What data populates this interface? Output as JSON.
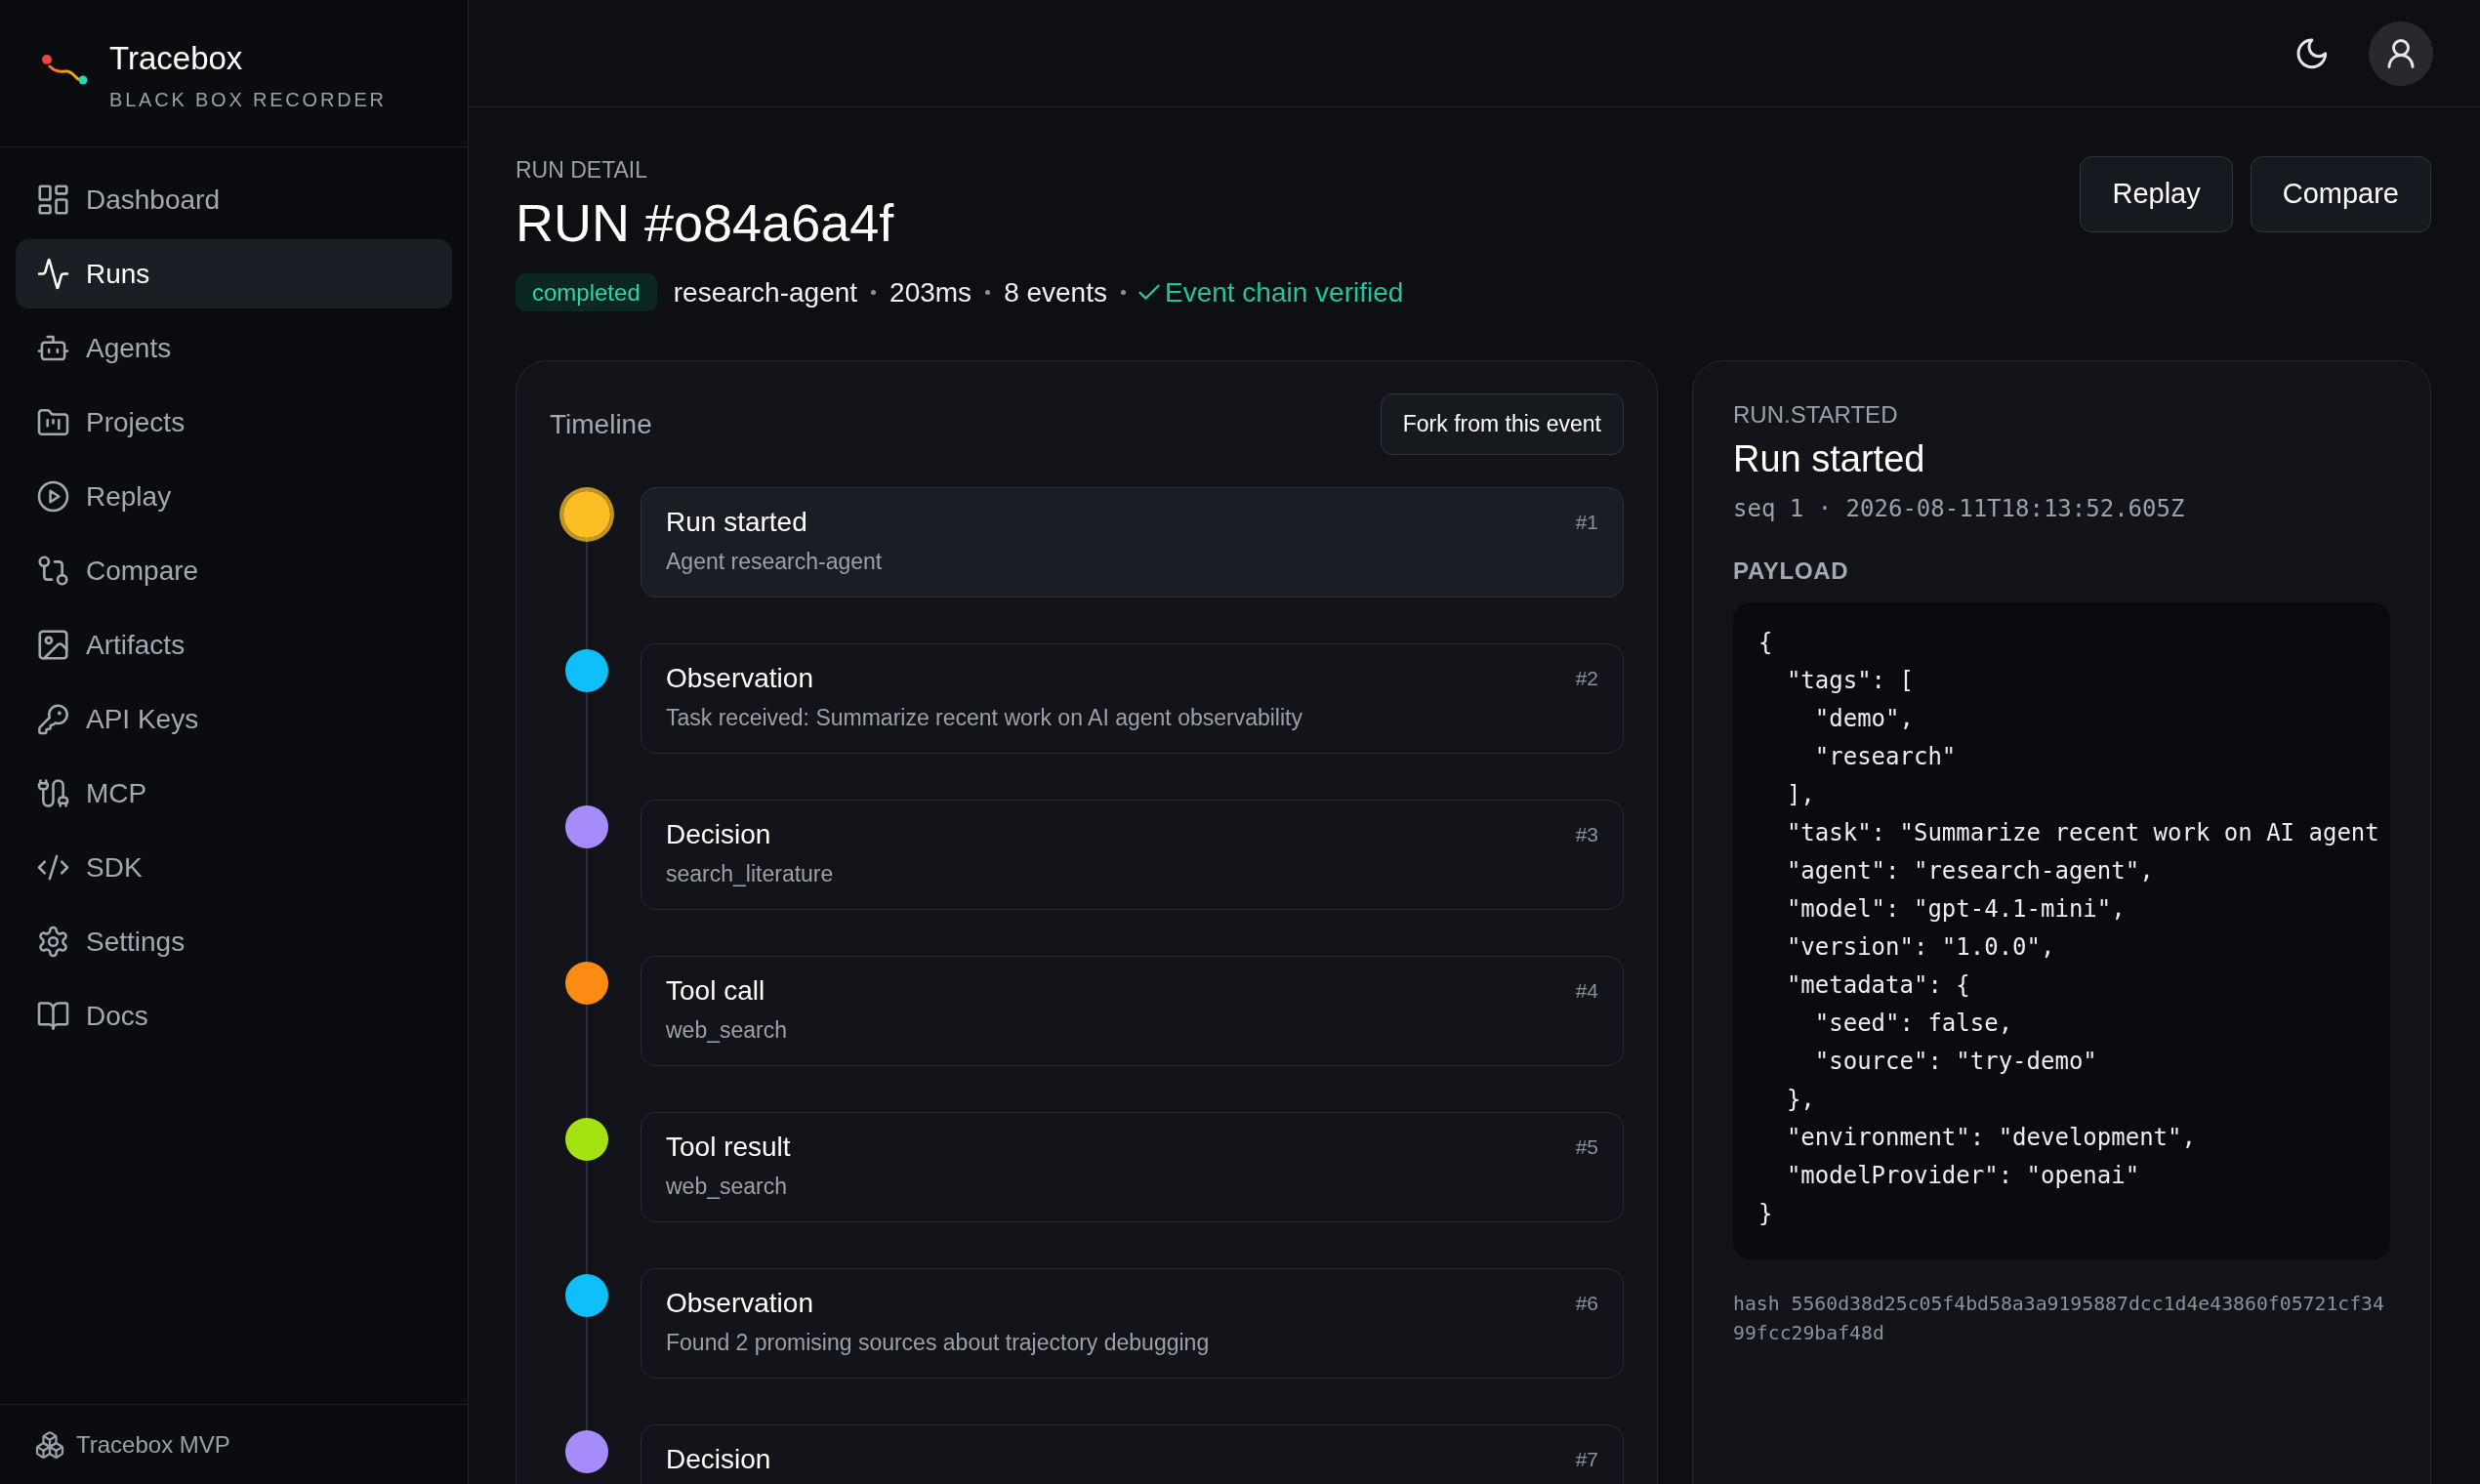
{
  "sidebar": {
    "brand": {
      "name": "Tracebox",
      "tagline": "BLACK BOX RECORDER"
    },
    "items": [
      {
        "label": "Dashboard",
        "selected": false
      },
      {
        "label": "Runs",
        "selected": true
      },
      {
        "label": "Agents",
        "selected": false
      },
      {
        "label": "Projects",
        "selected": false
      },
      {
        "label": "Replay",
        "selected": false
      },
      {
        "label": "Compare",
        "selected": false
      },
      {
        "label": "Artifacts",
        "selected": false
      },
      {
        "label": "API Keys",
        "selected": false
      },
      {
        "label": "MCP",
        "selected": false
      },
      {
        "label": "SDK",
        "selected": false
      },
      {
        "label": "Settings",
        "selected": false
      },
      {
        "label": "Docs",
        "selected": false
      }
    ],
    "footer": "Tracebox MVP"
  },
  "page": {
    "eyebrow": "RUN DETAIL",
    "title": "RUN #o84a6a4f",
    "status": "completed",
    "meta": [
      "research-agent",
      "203ms",
      "8 events"
    ],
    "verified": "Event chain verified",
    "actions": [
      "Replay",
      "Compare"
    ]
  },
  "timeline": {
    "title": "Timeline",
    "action": "Fork from this event",
    "events": [
      {
        "title": "Run started",
        "detail": "Agent research-agent",
        "seq": "#1",
        "color": "#fbbf24",
        "selected": true
      },
      {
        "title": "Observation",
        "detail": "Task received: Summarize recent work on AI agent observability",
        "seq": "#2",
        "color": "#0ebffa",
        "selected": false
      },
      {
        "title": "Decision",
        "detail": "search_literature",
        "seq": "#3",
        "color": "#a78bfa",
        "selected": false
      },
      {
        "title": "Tool call",
        "detail": "web_search",
        "seq": "#4",
        "color": "#fb8b12",
        "selected": false
      },
      {
        "title": "Tool result",
        "detail": "web_search",
        "seq": "#5",
        "color": "#a3e312",
        "selected": false
      },
      {
        "title": "Observation",
        "detail": "Found 2 promising sources about trajectory debugging",
        "seq": "#6",
        "color": "#0ebffa",
        "selected": false
      },
      {
        "title": "Decision",
        "seq": "#7",
        "color": "#a78bfa",
        "selected": false
      }
    ]
  },
  "detail": {
    "type": "RUN.STARTED",
    "title": "Run started",
    "meta": "seq 1 · 2026-08-11T18:13:52.605Z",
    "payload_label": "PAYLOAD",
    "payload_lines": [
      "{",
      "  \"tags\": [",
      "    \"demo\",",
      "    \"research\"",
      "  ],",
      "  \"task\": \"Summarize recent work on AI agent",
      "  \"agent\": \"research-agent\",",
      "  \"model\": \"gpt-4.1-mini\",",
      "  \"version\": \"1.0.0\",",
      "  \"metadata\": {",
      "    \"seed\": false,",
      "    \"source\": \"try-demo\"",
      "  },",
      "  \"environment\": \"development\",",
      "  \"modelProvider\": \"openai\"",
      "}"
    ],
    "hash": "hash 5560d38d25c05f4bd58a3a9195887dcc1d4e43860f05721cf3499fcc29baf48d"
  }
}
